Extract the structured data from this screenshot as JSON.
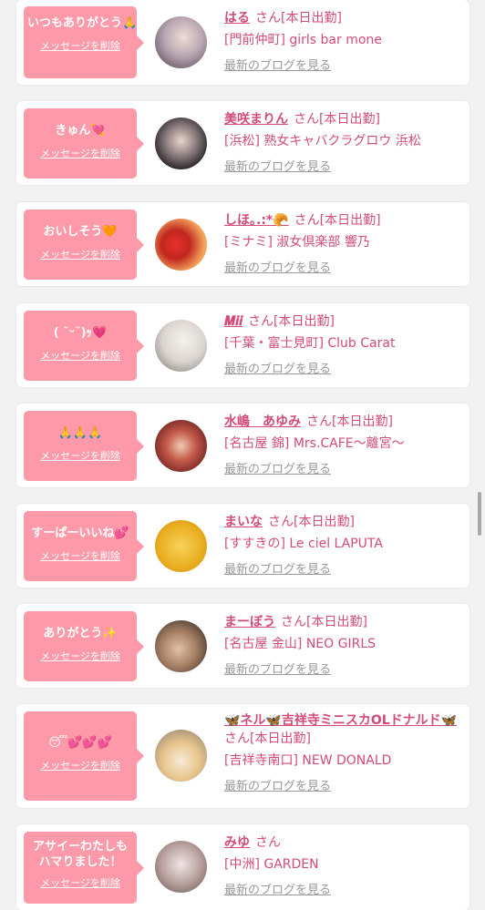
{
  "delete_label": "メッセージを削除",
  "blog_label": "最新のブログを見る",
  "colors": {
    "bubble": "#fd99a8",
    "name": "#d44b79",
    "link_gray": "#999999"
  },
  "items": [
    {
      "message": "いつもありがとう🙏",
      "name": "はる",
      "suffix": "さん[本日出勤]",
      "shop": "[門前仲町] girls bar mone"
    },
    {
      "message": "きゅん💘",
      "name": "美咲まりん",
      "suffix": "さん[本日出勤]",
      "shop": "[浜松] 熟女キャバクラグロウ 浜松"
    },
    {
      "message": "おいしそう🧡",
      "name": "しほ｡.:*🥐",
      "suffix": "さん[本日出勤]",
      "shop": "[ミナミ] 淑女倶楽部 響乃"
    },
    {
      "message": "( ˘ᵕ˘)ｯ💗",
      "name": "𝑴𝒊𝒊",
      "suffix": "さん[本日出勤]",
      "shop": "[千葉・富士見町] Club Carat"
    },
    {
      "message": "🙏🙏🙏",
      "name": "水嶋　あゆみ",
      "suffix": "さん[本日出勤]",
      "shop": "[名古屋 錦] Mrs.CAFE〜離宮〜"
    },
    {
      "message": "すーぱーいいね💕",
      "name": "まいな",
      "suffix": "さん[本日出勤]",
      "shop": "[すすきの] Le ciel LAPUTA"
    },
    {
      "message": "ありがとう✨",
      "name": "まーぼう",
      "suffix": "さん[本日出勤]",
      "shop": "[名古屋 金山] NEO GIRLS"
    },
    {
      "message": "😴💕💕💕",
      "name": "🦋ネル🦋吉祥寺ミニスカOLドナルド🦋",
      "suffix": "さん[本日出勤]",
      "shop": "[吉祥寺南口] NEW DONALD"
    },
    {
      "message": "アサイーわたしもハマりました！",
      "name": "みゆ",
      "suffix": "さん",
      "shop": "[中洲] GARDEN"
    }
  ]
}
